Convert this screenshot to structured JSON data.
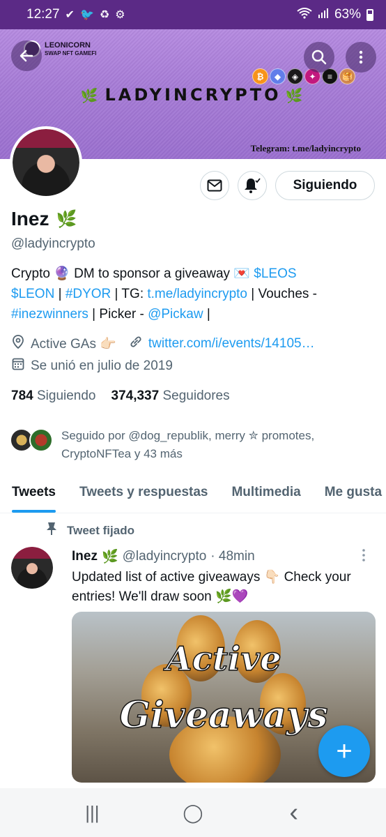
{
  "status_bar": {
    "time": "12:27",
    "left_icons": [
      "✔",
      "🐦",
      "♻",
      "⚙"
    ],
    "battery": "63%"
  },
  "banner": {
    "brand_name": "LEONICORN",
    "brand_sub": "SWAP NFT GAMEFI",
    "title": "LADYINCRYPTO",
    "leaf": "🌿",
    "telegram": "Telegram: t.me/ladyincrypto",
    "coins": [
      {
        "symbol": "₿",
        "color": "#f7931a"
      },
      {
        "symbol": "◆",
        "color": "#627eea"
      },
      {
        "symbol": "◈",
        "color": "#1a1a1a"
      },
      {
        "symbol": "✦",
        "color": "#c2187e"
      },
      {
        "symbol": "≡",
        "color": "#111111"
      },
      {
        "symbol": "🥞",
        "color": "#d1884f"
      }
    ]
  },
  "actions": {
    "mail_icon": "✉",
    "bell_icon": "🔔",
    "follow_label": "Siguiendo"
  },
  "profile": {
    "name": "Inez",
    "name_emoji": "🌿",
    "handle": "@ladyincrypto",
    "bio": {
      "p1": "Crypto 🔮 DM to sponsor a giveaway 💌 ",
      "leos": "$LEOS",
      "leon": "$LEON",
      "sep1": " | ",
      "dyor": "#DYOR",
      "p2": " | TG: ",
      "tg": "t.me/ladyincrypto",
      "p3": " | Vouches - ",
      "winners": "#inezwinners",
      "p4": " | Picker - ",
      "pickaw": "@Pickaw",
      "p5": " |"
    },
    "location": "Active GAs 👉🏻",
    "website": "twitter.com/i/events/14105…",
    "joined": "Se unió en julio de 2019",
    "following_count": "784",
    "following_label": "Siguiendo",
    "followers_count": "374,337",
    "followers_label": "Seguidores",
    "followed_by": "Seguido por @dog_republik, merry ✮ promotes, CryptoNFTea y 43 más"
  },
  "tabs": [
    "Tweets",
    "Tweets y respuestas",
    "Multimedia",
    "Me gusta"
  ],
  "pinned_tweet": {
    "pinned_label": "Tweet fijado",
    "name": "Inez",
    "name_emoji": "🌿",
    "handle": "@ladyincrypto",
    "time": "· 48min",
    "text": "Updated list of active giveaways 👇🏻 Check your entries! We'll draw soon 🌿💜",
    "media_text_1": "Active",
    "media_text_2": "Giveaways"
  },
  "fab_icon": "+",
  "nav": {
    "recents": "|||",
    "home": "◯",
    "back": "‹"
  }
}
